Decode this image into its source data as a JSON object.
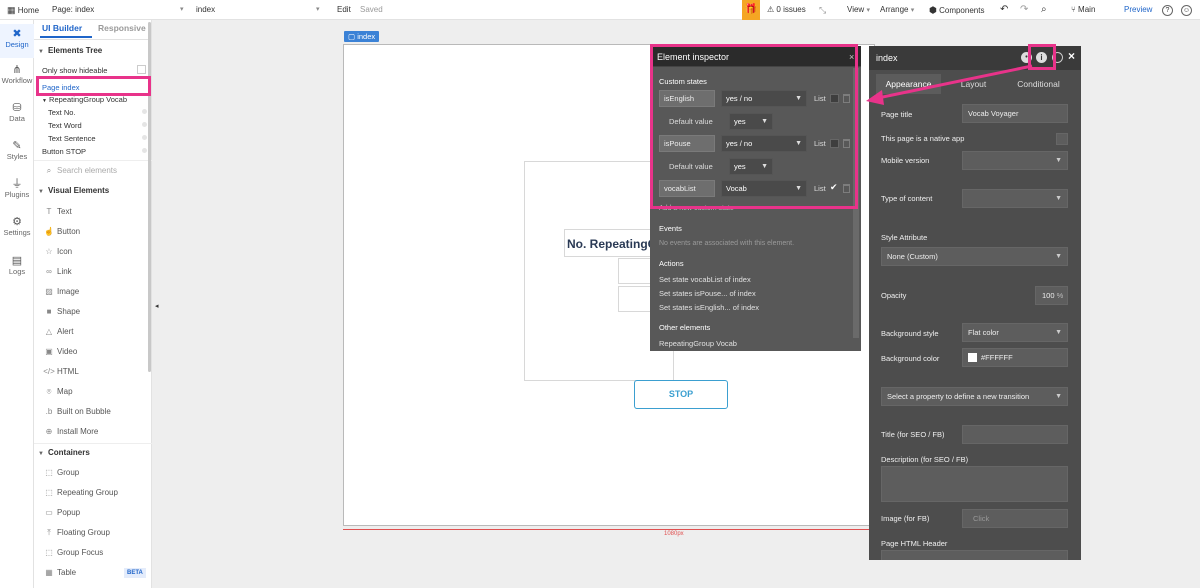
{
  "topbar": {
    "home_label": "Home",
    "page_label": "Page: index",
    "page_select": "index",
    "edit_label": "Edit",
    "saved_label": "Saved",
    "issues_label": "0 issues",
    "view_label": "View",
    "arrange_label": "Arrange",
    "components_label": "Components",
    "branch_label": "Main",
    "preview_label": "Preview"
  },
  "rail": {
    "items": [
      {
        "label": "Design",
        "icon": "design-icon"
      },
      {
        "label": "Workflow",
        "icon": "workflow-icon"
      },
      {
        "label": "Data",
        "icon": "data-icon"
      },
      {
        "label": "Styles",
        "icon": "styles-icon"
      },
      {
        "label": "Plugins",
        "icon": "plugins-icon"
      },
      {
        "label": "Settings",
        "icon": "settings-icon"
      },
      {
        "label": "Logs",
        "icon": "logs-icon"
      }
    ]
  },
  "palette": {
    "tab_builder": "UI Builder",
    "tab_responsive": "Responsive",
    "elements_tree_heading": "Elements Tree",
    "only_hideable": "Only show hideable",
    "tree": [
      "Page index",
      "RepeatingGroup Vocab",
      "Text No.",
      "Text Word",
      "Text Sentence",
      "Button STOP"
    ],
    "search_placeholder": "Search elements",
    "visual_heading": "Visual Elements",
    "visual": [
      "Text",
      "Button",
      "Icon",
      "Link",
      "Image",
      "Shape",
      "Alert",
      "Video",
      "HTML",
      "Map",
      "Built on Bubble",
      "Install More"
    ],
    "containers_heading": "Containers",
    "containers": [
      "Group",
      "Repeating Group",
      "Popup",
      "Floating Group",
      "Group Focus",
      "Table"
    ],
    "beta_badge": "BETA"
  },
  "canvas": {
    "page_tag": "index",
    "repeating_text": "No. RepeatingGroup",
    "stop_button": "STOP",
    "width_label": "1080px"
  },
  "inspector": {
    "title": "Element inspector",
    "custom_states_heading": "Custom states",
    "states": [
      {
        "name": "isEnglish",
        "type": "yes / no",
        "list_label": "List",
        "list_checked": false
      },
      {
        "name": "isPouse",
        "type": "yes / no",
        "list_label": "List",
        "list_checked": false
      },
      {
        "name": "vocabList",
        "type": "Vocab",
        "list_label": "List",
        "list_checked": true
      }
    ],
    "default_label": "Default value",
    "default_values": [
      "yes",
      "yes"
    ],
    "add_state": "Add a new custom state",
    "events_heading": "Events",
    "events_empty": "No events are associated with this element.",
    "actions_heading": "Actions",
    "actions": [
      "Set state vocabList of index",
      "Set states isPouse... of index",
      "Set states isEnglish... of index"
    ],
    "other_heading": "Other elements",
    "other_elements": [
      "RepeatingGroup Vocab"
    ]
  },
  "property_editor": {
    "title": "index",
    "tabs": [
      "Appearance",
      "Layout",
      "Conditional"
    ],
    "page_title_label": "Page title",
    "page_title_value": "Vocab Voyager",
    "native_app_label": "This page is a native app",
    "mobile_version_label": "Mobile version",
    "type_of_content_label": "Type of content",
    "style_attribute_label": "Style Attribute",
    "style_attribute_value": "None (Custom)",
    "opacity_label": "Opacity",
    "opacity_value": "100",
    "opacity_unit": "%",
    "bg_style_label": "Background style",
    "bg_style_value": "Flat color",
    "bg_color_label": "Background color",
    "bg_color_value": "#FFFFFF",
    "transition_label": "Select a property to define a new transition",
    "seo_title_label": "Title (for SEO / FB)",
    "seo_desc_label": "Description (for SEO / FB)",
    "image_fb_label": "Image (for FB)",
    "image_fb_placeholder": "Click",
    "html_header_label": "Page HTML Header"
  },
  "colors": {
    "accent_blue": "#1f65c9",
    "highlight_pink": "#e8338a",
    "gift_orange": "#f5a623",
    "stop_blue": "#3b9fd0"
  }
}
